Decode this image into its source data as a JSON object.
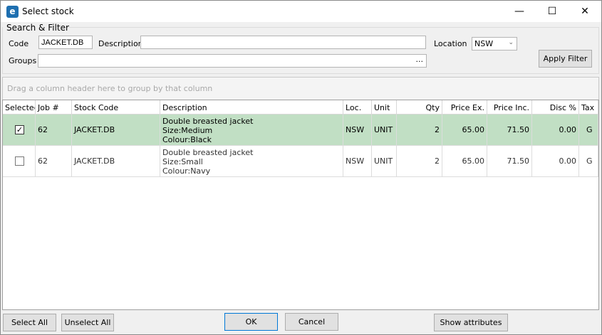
{
  "window": {
    "title": "Select stock",
    "minimize": "—",
    "maximize": "☐",
    "close": "✕",
    "icon": "app-logo-icon"
  },
  "filter": {
    "group_title": "Search & Filter",
    "code_label": "Code",
    "code_value": "JACKET.DB",
    "description_label": "Description",
    "description_value": "",
    "location_label": "Location",
    "location_value": "NSW",
    "groups_label": "Groups",
    "groups_value": "",
    "groups_ellipsis": "...",
    "apply_label": "Apply Filter"
  },
  "grid": {
    "group_hint": "Drag a column header here to group by that column",
    "columns": [
      "Selected",
      "Job #",
      "Stock Code",
      "Description",
      "Loc.",
      "Unit",
      "Qty",
      "Price Ex.",
      "Price Inc.",
      "Disc %",
      "Tax"
    ],
    "rows": [
      {
        "selected": true,
        "job": "62",
        "code": "JACKET.DB",
        "desc1": "Double breasted jacket",
        "desc2": "Size:Medium",
        "desc3": "Colour:Black",
        "loc": "NSW",
        "unit": "UNIT",
        "qty": "2",
        "price_ex": "65.00",
        "price_inc": "71.50",
        "disc": "0.00",
        "tax": "G"
      },
      {
        "selected": false,
        "job": "62",
        "code": "JACKET.DB",
        "desc1": "Double breasted jacket",
        "desc2": "Size:Small",
        "desc3": "Colour:Navy",
        "loc": "NSW",
        "unit": "UNIT",
        "qty": "2",
        "price_ex": "65.00",
        "price_inc": "71.50",
        "disc": "0.00",
        "tax": "G"
      }
    ]
  },
  "footer": {
    "select_all": "Select All",
    "unselect_all": "Unselect All",
    "ok": "OK",
    "cancel": "Cancel",
    "show_attributes": "Show attributes"
  },
  "colors": {
    "selected_row": "#c1dfc4",
    "ok_border": "#0078d7"
  }
}
